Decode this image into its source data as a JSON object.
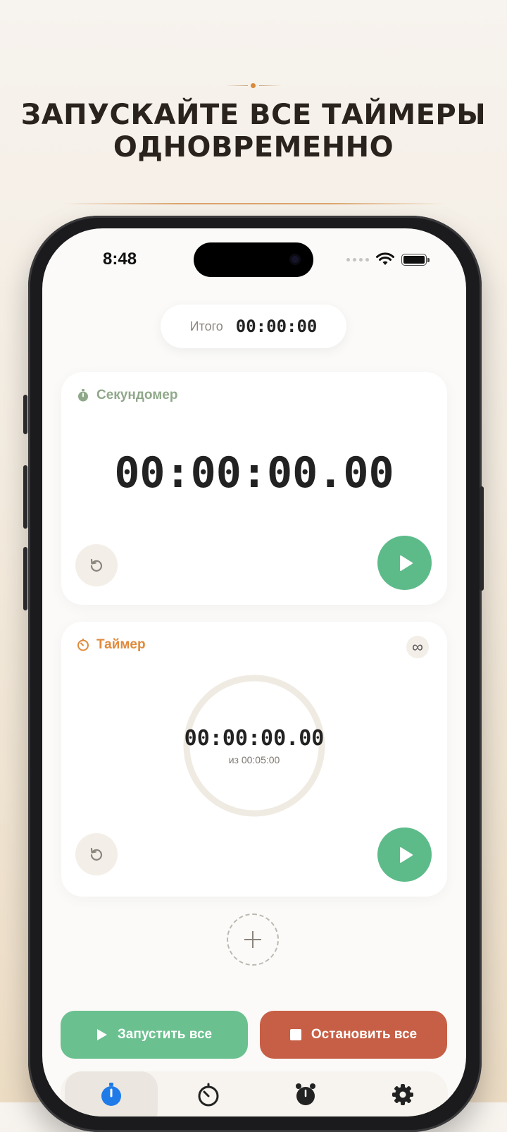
{
  "promo": {
    "headline_line1": "ЗАПУСКАЙТЕ ВСЕ ТАЙМЕРЫ",
    "headline_line2": "ОДНОВРЕМЕННО"
  },
  "status_bar": {
    "time": "8:48"
  },
  "total": {
    "label": "Итого",
    "value": "00:00:00"
  },
  "stopwatch_card": {
    "title": "Секундомер",
    "display": "00:00:00.00",
    "title_color": "#8fa88a"
  },
  "timer_card": {
    "title": "Таймер",
    "display": "00:00:00.00",
    "subtitle": "из 00:05:00",
    "repeat_icon": "∞",
    "title_color": "#e08a3c"
  },
  "actions": {
    "start_all": "Запустить все",
    "stop_all": "Остановить все"
  },
  "tabs": [
    {
      "icon": "stopwatch-icon",
      "active": true
    },
    {
      "icon": "timer-icon",
      "active": false
    },
    {
      "icon": "alarm-icon",
      "active": false
    },
    {
      "icon": "gear-icon",
      "active": false
    }
  ],
  "colors": {
    "accent_green": "#5dbb8a",
    "stop_red": "#c75f46",
    "tab_active_blue": "#1f7be8"
  }
}
